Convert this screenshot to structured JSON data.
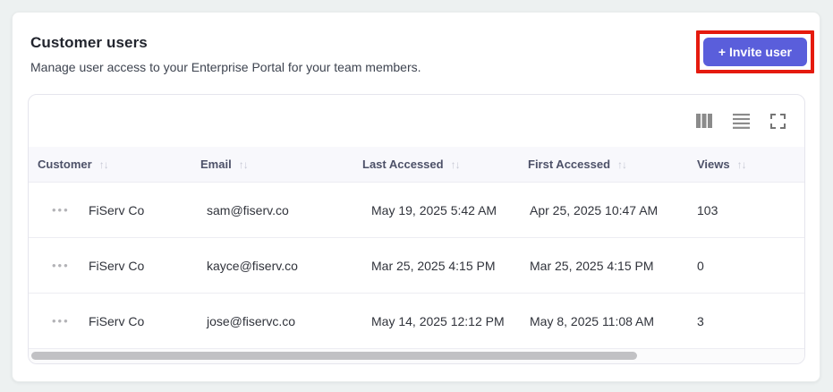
{
  "panel": {
    "title": "Customer users",
    "subtitle": "Manage user access to your Enterprise Portal for your team members.",
    "invite_button_label": "+ Invite user",
    "accent_color": "#5a5edb",
    "highlight_color": "#e51a0e"
  },
  "table": {
    "sort_glyph": "↑↓",
    "actions_glyph": "•••",
    "columns": [
      {
        "label": "Customer"
      },
      {
        "label": "Email"
      },
      {
        "label": "Last Accessed"
      },
      {
        "label": "First Accessed"
      },
      {
        "label": "Views"
      }
    ],
    "rows": [
      {
        "customer": "FiServ Co",
        "email": "sam@fiserv.co",
        "last_accessed": "May 19, 2025 5:42 AM",
        "first_accessed": "Apr 25, 2025 10:47 AM",
        "views": "103"
      },
      {
        "customer": "FiServ Co",
        "email": "kayce@fiserv.co",
        "last_accessed": "Mar 25, 2025 4:15 PM",
        "first_accessed": "Mar 25, 2025 4:15 PM",
        "views": "0"
      },
      {
        "customer": "FiServ Co",
        "email": "jose@fiservc.co",
        "last_accessed": "May 14, 2025 12:12 PM",
        "first_accessed": "May 8, 2025 11:08 AM",
        "views": "3"
      }
    ]
  }
}
